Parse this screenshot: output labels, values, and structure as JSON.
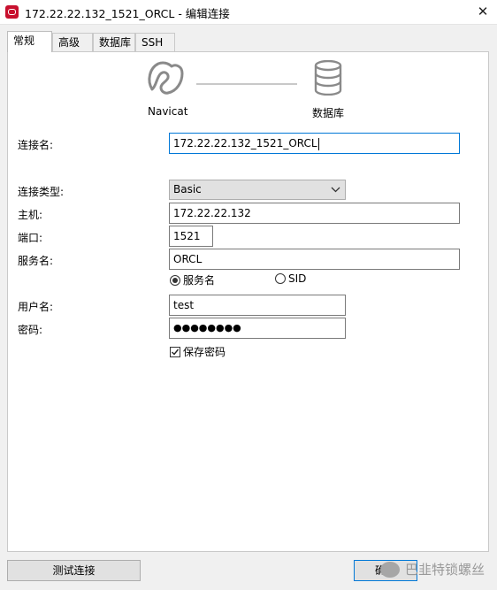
{
  "window": {
    "title": "172.22.22.132_1521_ORCL - 编辑连接",
    "close_glyph": "✕"
  },
  "tabs": [
    {
      "label": "常规",
      "active": true
    },
    {
      "label": "高级",
      "active": false
    },
    {
      "label": "数据库",
      "active": false
    },
    {
      "label": "SSH",
      "active": false
    }
  ],
  "diagram": {
    "left_label": "Navicat",
    "right_label": "数据库"
  },
  "form": {
    "connection_name": {
      "label": "连接名:",
      "value": "172.22.22.132_1521_ORCL"
    },
    "connection_type": {
      "label": "连接类型:",
      "value": "Basic"
    },
    "host": {
      "label": "主机:",
      "value": "172.22.22.132"
    },
    "port": {
      "label": "端口:",
      "value": "1521"
    },
    "service_name": {
      "label": "服务名:",
      "value": "ORCL"
    },
    "service_type": {
      "option_service": "服务名",
      "option_sid": "SID",
      "selected": "服务名"
    },
    "username": {
      "label": "用户名:",
      "value": "test"
    },
    "password": {
      "label": "密码:",
      "value": "●●●●●●●●"
    },
    "save_password": {
      "label": "保存密码",
      "checked": true
    }
  },
  "buttons": {
    "test_connection": "测试连接",
    "ok": "确定"
  },
  "watermark": {
    "text": "巴韭特锁螺丝"
  },
  "icons": {
    "app": "navicat-app-icon",
    "navicat": "navicat-logo-icon",
    "database": "database-icon"
  }
}
